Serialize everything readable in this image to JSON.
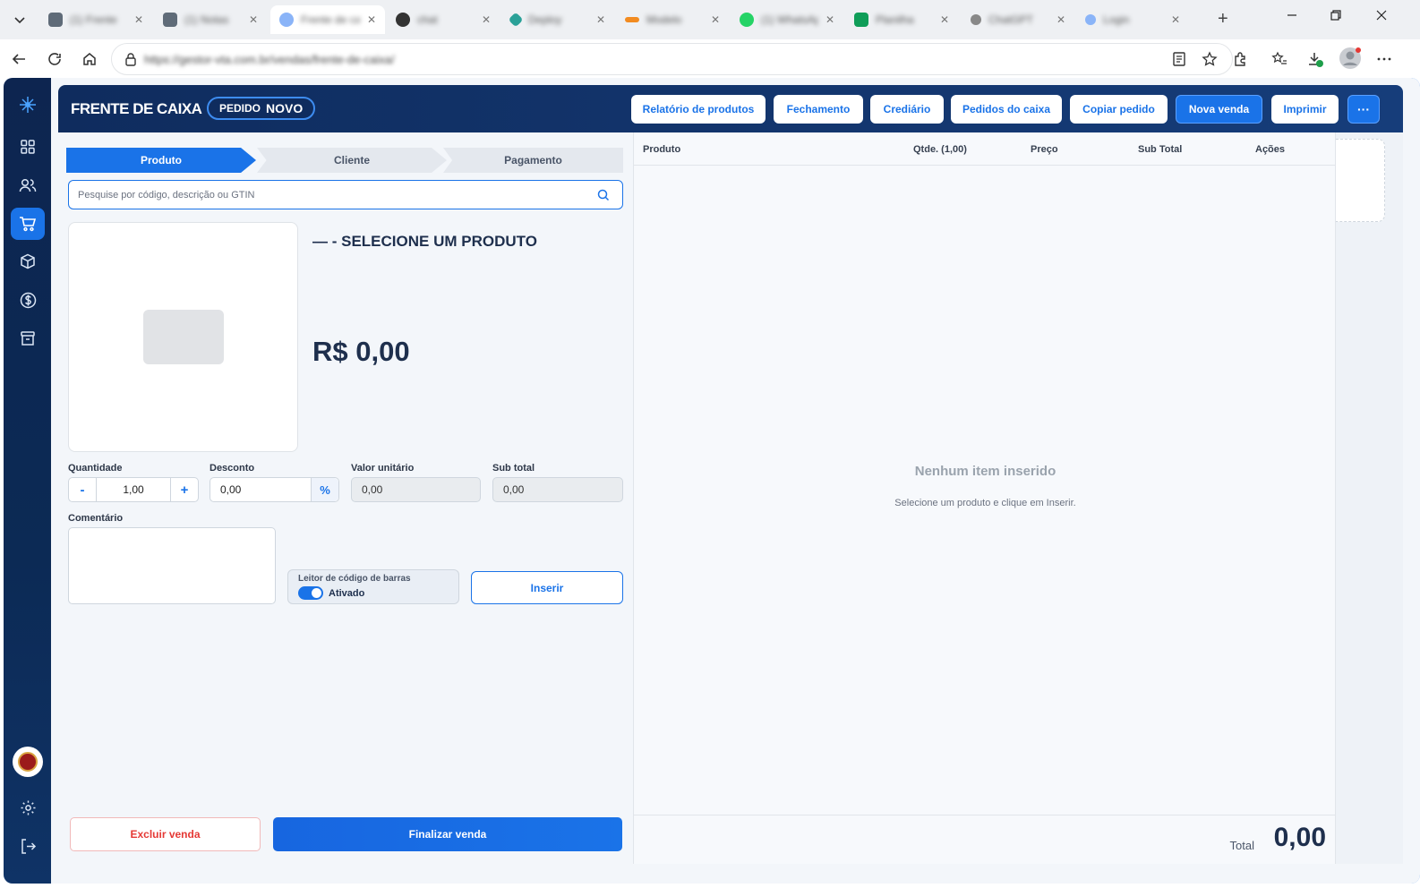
{
  "browser": {
    "tabs": [
      {
        "title": "(1) Frente",
        "color": "#5f6b78"
      },
      {
        "title": "(1) Notas",
        "color": "#5f6b78"
      },
      {
        "title": "Frente de caixa",
        "color": "#8ab4f8"
      },
      {
        "title": "chat",
        "color": "#333333"
      },
      {
        "title": "Deploy",
        "color": "#2aa198"
      },
      {
        "title": "Modelo",
        "color": "#f28b20"
      },
      {
        "title": "(1) WhatsApp",
        "color": "#25d366"
      },
      {
        "title": "Planilha",
        "color": "#0f9d58"
      },
      {
        "title": "ChatGPT",
        "color": "#888888"
      },
      {
        "title": "Login",
        "color": "#8ab4f8"
      }
    ],
    "url": "https://gestor-vta.com.br/vendas/frente-de-caixa/"
  },
  "header": {
    "title": "FRENTE DE CAIXA",
    "badge_prefix": "PEDIDO",
    "badge_status": "NOVO",
    "buttons": {
      "relatorio": "Relatório de produtos",
      "fechamento": "Fechamento",
      "crediario": "Crediário",
      "pedidos": "Pedidos do caixa",
      "copiar": "Copiar pedido",
      "nova": "Nova venda",
      "imprimir": "Imprimir",
      "more": "···"
    }
  },
  "steps": {
    "produto": "Produto",
    "cliente": "Cliente",
    "pagamento": "Pagamento"
  },
  "search": {
    "placeholder": "Pesquise por código, descrição ou GTIN"
  },
  "product": {
    "name": "— - SELECIONE UM PRODUTO",
    "price": "R$ 0,00"
  },
  "fields": {
    "quantidade_label": "Quantidade",
    "quantidade_minus": "-",
    "quantidade_value": "1,00",
    "quantidade_plus": "+",
    "desconto_label": "Desconto",
    "desconto_value": "0,00",
    "desconto_unit": "%",
    "valor_unitario_label": "Valor unitário",
    "valor_unitario_value": "0,00",
    "sub_total_label": "Sub total",
    "sub_total_value": "0,00",
    "comentario_label": "Comentário"
  },
  "barcode": {
    "label": "Leitor de código de barras",
    "status": "Ativado",
    "enabled": true
  },
  "actions": {
    "inserir": "Inserir",
    "excluir": "Excluir venda",
    "finalizar": "Finalizar venda"
  },
  "table": {
    "columns": {
      "produto": "Produto",
      "qtde": "Qtde. (1,00)",
      "preco": "Preço",
      "subtotal": "Sub Total",
      "acoes": "Ações"
    },
    "empty_title": "Nenhum item inserido",
    "empty_subtitle": "Selecione um produto e clique em Inserir."
  },
  "total": {
    "label": "Total",
    "value": "0,00"
  },
  "colors": {
    "accent": "#1a73e8",
    "header": "#0f2c5e",
    "danger": "#e53935"
  }
}
